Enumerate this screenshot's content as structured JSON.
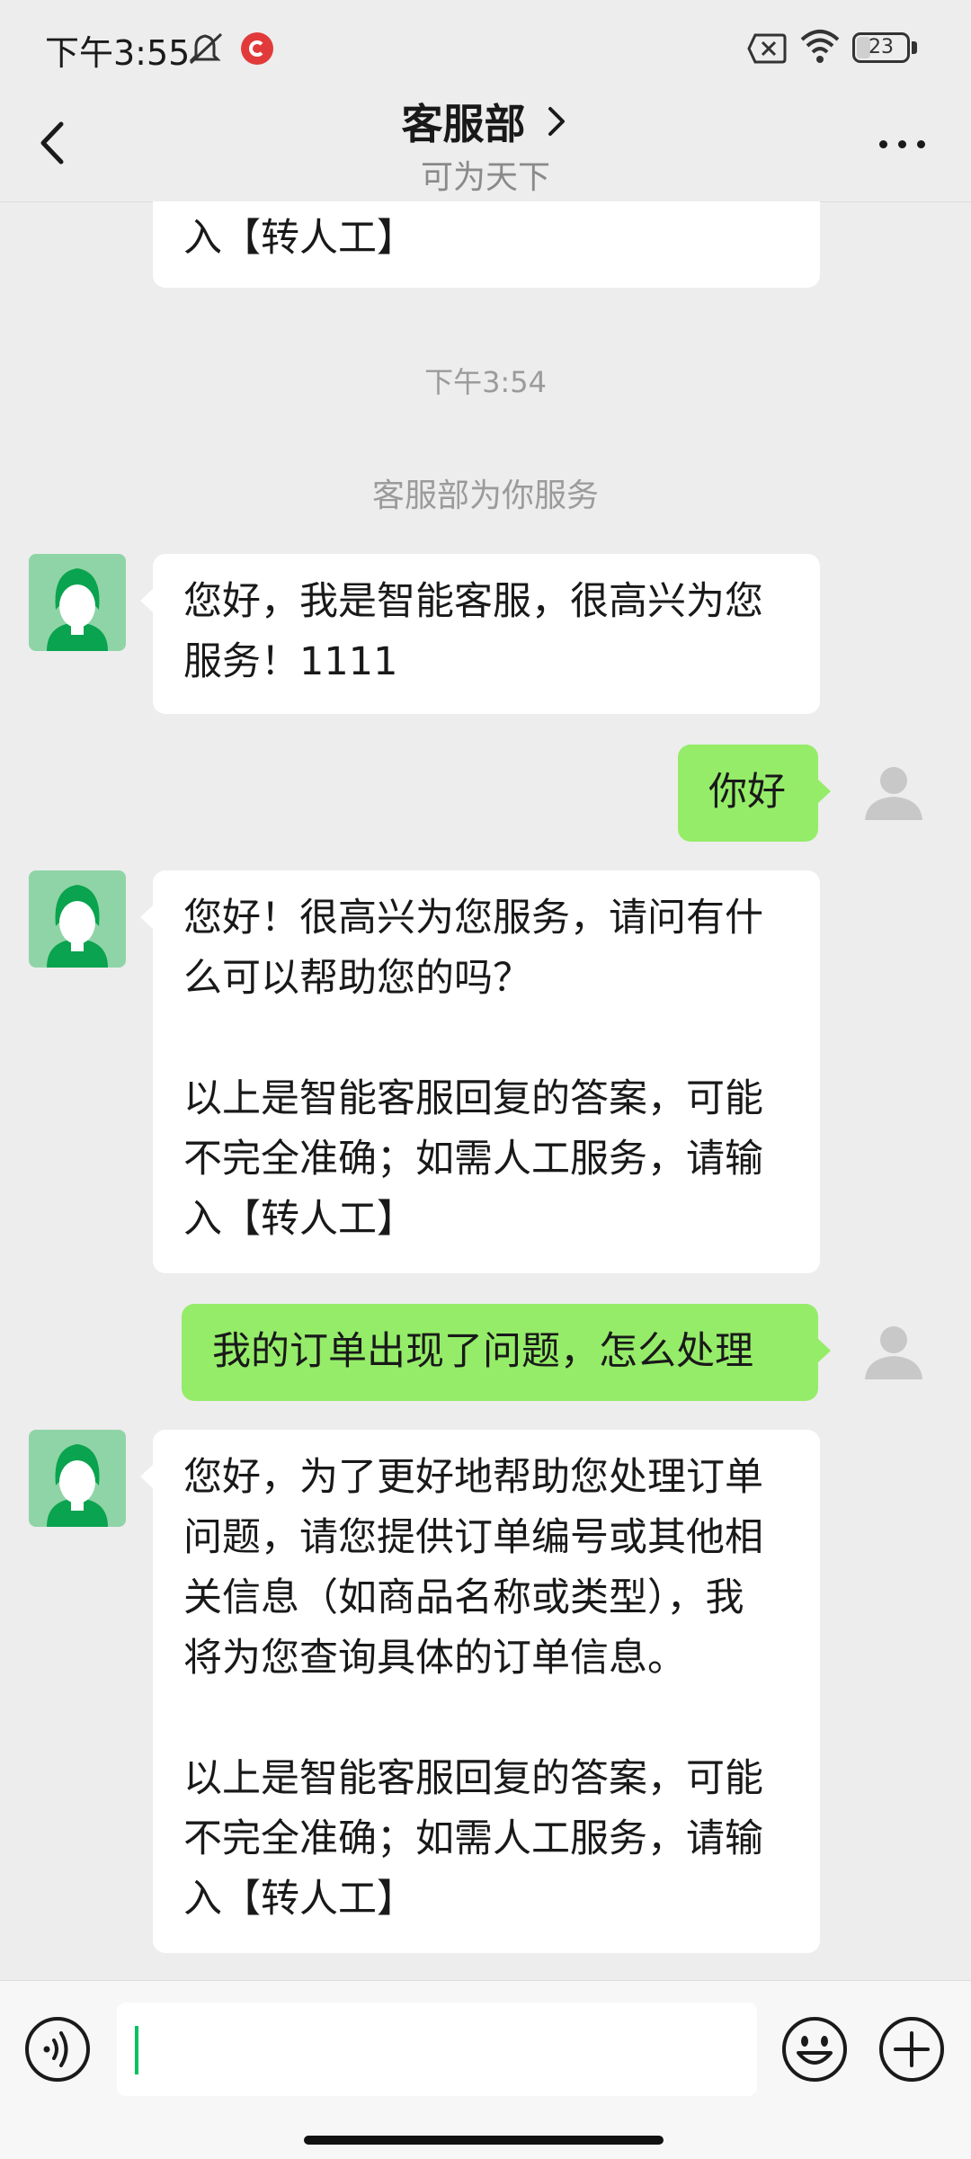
{
  "status_bar": {
    "time": "下午3:55",
    "battery": "23",
    "icons": [
      "mute-icon",
      "app-notification-icon",
      "sim-off-icon",
      "wifi-icon",
      "battery-icon"
    ]
  },
  "nav": {
    "title": "客服部",
    "subtitle": "可为天下",
    "back_icon": "chevron-left-icon",
    "title_icon": "chevron-right-icon",
    "more_icon": "more-dots-icon"
  },
  "messages": {
    "partial_top": "入【转人工】",
    "timestamp": "下午3:54",
    "system_note": "客服部为你服务",
    "agent_1": "您好，我是智能客服，很高兴为您\n服务！1111",
    "user_1": "你好",
    "agent_2": "您好！很高兴为您服务，请问有什\n么可以帮助您的吗？\n\n以上是智能客服回复的答案，可能\n不完全准确；如需人工服务，请输\n入【转人工】",
    "user_2": "我的订单出现了问题，怎么处理",
    "agent_3": "您好，为了更好地帮助您处理订单\n问题，请您提供订单编号或其他相\n关信息（如商品名称或类型），我\n将为您查询具体的订单信息。\n\n以上是智能客服回复的答案，可能\n不完全准确；如需人工服务，请输\n入【转人工】"
  },
  "colors": {
    "background": "#ededed",
    "user_bubble": "#95ec69",
    "agent_bubble": "#ffffff",
    "agent_avatar": "#8fd4a6",
    "accent_caret": "#07c160"
  },
  "input_bar": {
    "value": "",
    "icons": [
      "voice-icon",
      "emoji-icon",
      "plus-icon"
    ]
  }
}
